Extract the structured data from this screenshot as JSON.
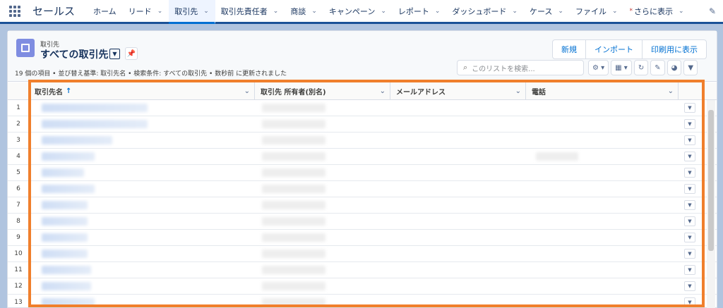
{
  "app": {
    "name": "セールス"
  },
  "nav": {
    "items": [
      {
        "label": "ホーム",
        "chevron": false
      },
      {
        "label": "リード",
        "chevron": true
      },
      {
        "label": "取引先",
        "chevron": true,
        "active": true
      },
      {
        "label": "取引先責任者",
        "chevron": true
      },
      {
        "label": "商談",
        "chevron": true
      },
      {
        "label": "キャンペーン",
        "chevron": true
      },
      {
        "label": "レポート",
        "chevron": true
      },
      {
        "label": "ダッシュボード",
        "chevron": true
      },
      {
        "label": "ケース",
        "chevron": true
      },
      {
        "label": "ファイル",
        "chevron": true
      },
      {
        "label": "さらに表示",
        "chevron": true,
        "star": true
      }
    ]
  },
  "header": {
    "object_label": "取引先",
    "list_title": "すべての取引先",
    "buttons": [
      "新規",
      "インポート",
      "印刷用に表示"
    ],
    "info": "19 個の項目 • 並び替え基準: 取引先名 • 検索条件: すべての取引先 • 数秒前 に更新されました",
    "search_placeholder": "このリストを検索..."
  },
  "table": {
    "columns": [
      "取引先名",
      "取引先 所有者(別名)",
      "メールアドレス",
      "電話"
    ],
    "sort_arrow": "↑",
    "row_numbers": [
      "1",
      "2",
      "3",
      "4",
      "5",
      "6",
      "7",
      "8",
      "9",
      "10",
      "11",
      "12",
      "13"
    ]
  },
  "colors": {
    "nav_accent": "#0070d2",
    "highlight": "#f07f2c",
    "header_bar": "#1b5297"
  },
  "icons": [
    "app-launcher-icon",
    "account-object-icon",
    "pin-icon",
    "search-icon",
    "gear-icon",
    "table-icon",
    "refresh-icon",
    "pencil-icon",
    "chart-icon",
    "filter-icon",
    "edit-nav-icon"
  ]
}
